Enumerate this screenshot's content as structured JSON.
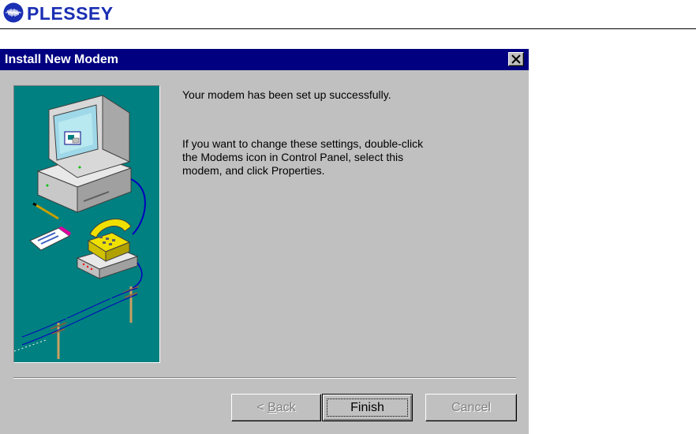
{
  "header": {
    "brand": "PLESSEY",
    "logo_icon": "plessey-waveform-logo-icon",
    "brand_color": "#1a2fb3"
  },
  "dialog": {
    "title": "Install New Modem",
    "close_icon": "close-icon",
    "message_primary": "Your modem has been set up successfully.",
    "message_secondary": "If you want to change these settings, double-click\nthe Modems icon in Control Panel, select this\nmodem, and click Properties.",
    "illustration": "computer-modem-telephone-illustration",
    "buttons": {
      "back_prefix": "< ",
      "back_accel": "B",
      "back_rest": "ack",
      "back_enabled": false,
      "finish": "Finish",
      "finish_enabled": true,
      "cancel": "Cancel",
      "cancel_enabled": false
    },
    "colors": {
      "titlebar": "#000080",
      "face": "#c0c0c0",
      "illustration_bg": "#008080"
    }
  }
}
